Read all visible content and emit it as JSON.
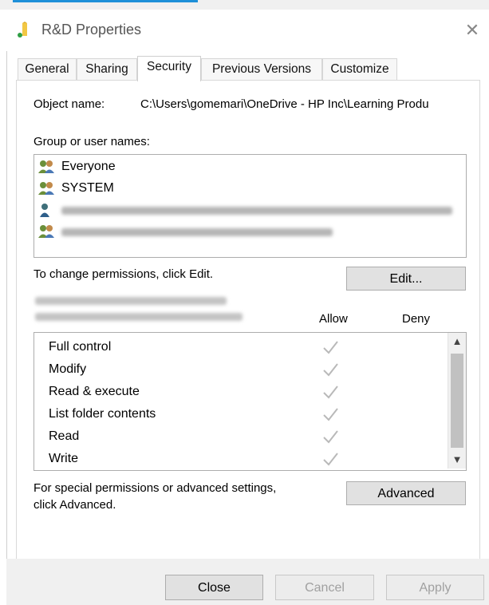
{
  "window": {
    "title": "R&D Properties",
    "close_glyph": "✕",
    "folder_icon": "folder-icon"
  },
  "tabs": [
    {
      "label": "General"
    },
    {
      "label": "Sharing"
    },
    {
      "label": "Security"
    },
    {
      "label": "Previous Versions"
    },
    {
      "label": "Customize"
    }
  ],
  "object": {
    "label": "Object name:",
    "value": "C:\\Users\\gomemari\\OneDrive - HP Inc\\Learning Produ"
  },
  "groups": {
    "label": "Group or user names:",
    "items": [
      {
        "name": "Everyone",
        "icon": "group-users-icon"
      },
      {
        "name": "SYSTEM",
        "icon": "group-users-icon"
      },
      {
        "name": "",
        "icon": "user-icon",
        "redacted": true
      },
      {
        "name": "",
        "icon": "group-users-icon",
        "redacted": true
      }
    ]
  },
  "change_text": "To change permissions, click Edit.",
  "edit_button": "Edit...",
  "permissions": {
    "allow_label": "Allow",
    "deny_label": "Deny",
    "items": [
      {
        "name": "Full control",
        "allow": true
      },
      {
        "name": "Modify",
        "allow": true
      },
      {
        "name": "Read & execute",
        "allow": true
      },
      {
        "name": "List folder contents",
        "allow": true
      },
      {
        "name": "Read",
        "allow": true
      },
      {
        "name": "Write",
        "allow": true
      }
    ]
  },
  "advanced_text_line1": "For special permissions or advanced settings,",
  "advanced_text_line2": "click Advanced.",
  "advanced_button": "Advanced",
  "buttons": {
    "close": "Close",
    "cancel": "Cancel",
    "apply": "Apply"
  },
  "colors": {
    "accent": "#1e90d8",
    "check": "#b9b9b9"
  }
}
